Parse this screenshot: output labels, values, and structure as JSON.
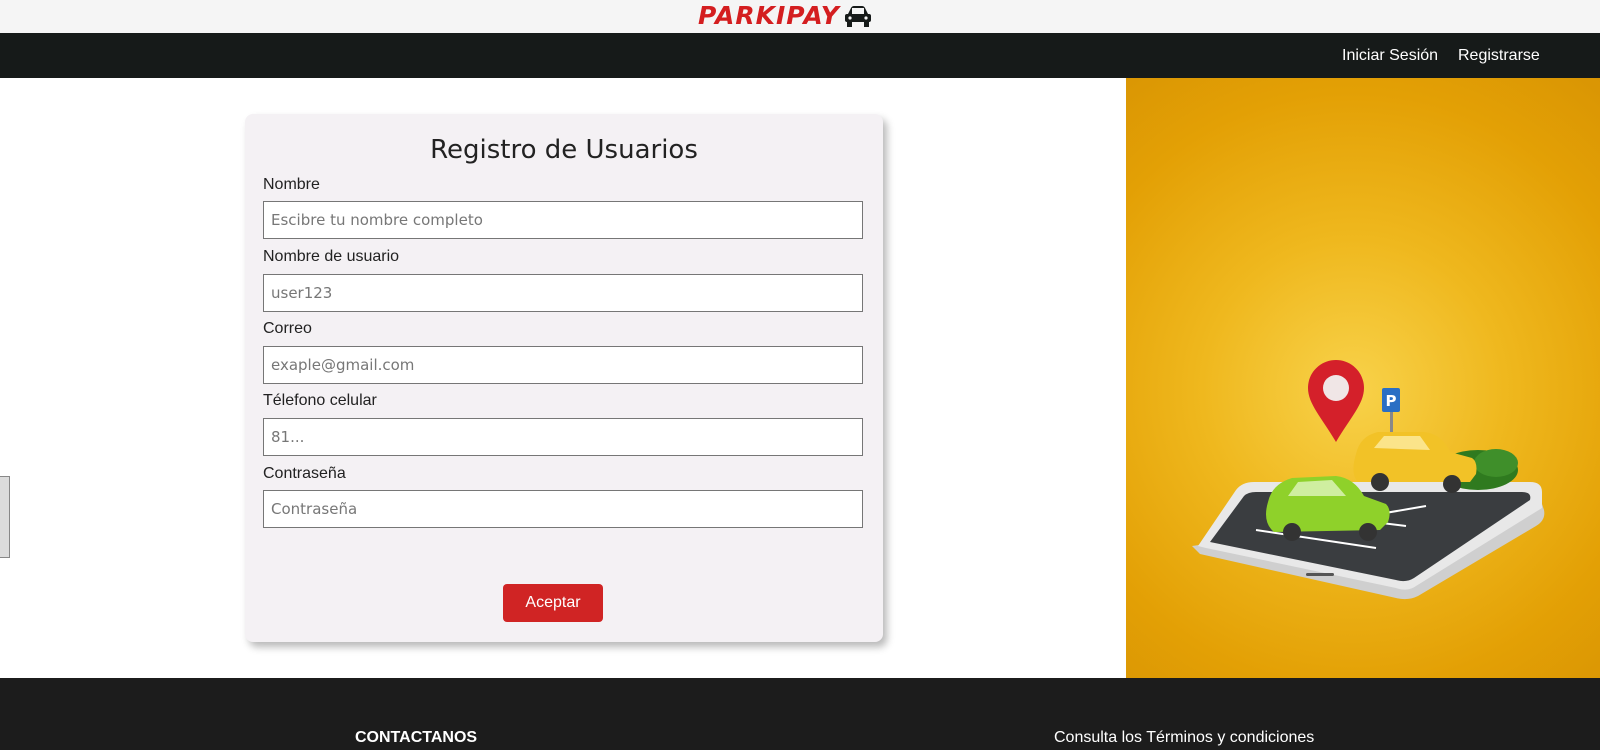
{
  "brand": {
    "name": "PARKIPAY",
    "color": "#d41e20"
  },
  "nav": {
    "login_label": "Iniciar Sesión",
    "register_label": "Registrarse"
  },
  "form": {
    "title": "Registro de Usuarios",
    "fields": [
      {
        "label": "Nombre",
        "placeholder": "Escibre tu nombre completo",
        "value": ""
      },
      {
        "label": "Nombre de usuario",
        "placeholder": "user123",
        "value": ""
      },
      {
        "label": "Correo",
        "placeholder": "exaple@gmail.com",
        "value": ""
      },
      {
        "label": "Télefono celular",
        "placeholder": "81...",
        "value": ""
      },
      {
        "label": "Contraseña",
        "placeholder": "Contraseña",
        "value": ""
      }
    ],
    "submit_label": "Aceptar"
  },
  "hero": {
    "parking_sign": "P"
  },
  "footer": {
    "contact_heading": "CONTACTANOS",
    "terms_link": "Consulta los Términos y condiciones"
  },
  "colors": {
    "accent": "#d02424",
    "navbar": "#161a19",
    "footer": "#1c1c1c",
    "hero": "#efb81e"
  },
  "icons": [
    "car-icon",
    "location-pin-icon",
    "parking-sign-icon"
  ]
}
